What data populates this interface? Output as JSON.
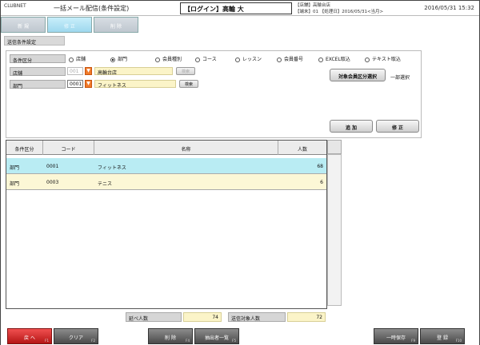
{
  "header": {
    "brand": "CLUBNET",
    "title": "一括メール配信(条件設定)",
    "login": "【ログイン】高輪 大",
    "store_line1": "【店舗】高輪台店",
    "store_line2": "【端末】01 【処理日】2016/05/31<当月>",
    "datetime": "2016/05/31 15:32"
  },
  "tabs": [
    {
      "label": "新 規"
    },
    {
      "label": "修 正"
    },
    {
      "label": "削 除"
    }
  ],
  "section_label": "送信条件設定",
  "conditions": {
    "category_label": "条件区分",
    "radios": [
      {
        "label": "店舗",
        "selected": false
      },
      {
        "label": "部門",
        "selected": true
      },
      {
        "label": "会員種別",
        "selected": false
      },
      {
        "label": "コース",
        "selected": false
      },
      {
        "label": "レッスン",
        "selected": false
      },
      {
        "label": "会員番号",
        "selected": false
      },
      {
        "label": "EXCEL取込",
        "selected": false
      },
      {
        "label": "テキスト取込",
        "selected": false
      }
    ],
    "store": {
      "label": "店舗",
      "code": "001",
      "name": "高輪台店",
      "search_label": "検索"
    },
    "dept": {
      "label": "部門",
      "code": "0001",
      "name": "フィットネス",
      "search_label": "検索"
    },
    "select_category_button": "対象会員区分選択",
    "partial_selection": "一部選択",
    "add_button": "追 加",
    "edit_button": "修 正"
  },
  "table": {
    "columns": [
      "条件区分",
      "コード",
      "名称",
      "人数"
    ],
    "rows": [
      {
        "category": "部門",
        "code": "0001",
        "name": "フィットネス",
        "count": "68"
      },
      {
        "category": "部門",
        "code": "0003",
        "name": "テニス",
        "count": "6"
      }
    ]
  },
  "totals": {
    "gross_label": "延べ人数",
    "gross_value": "74",
    "target_label": "送信対象人数",
    "target_value": "72"
  },
  "footer": [
    {
      "label": "戻 へ",
      "fkey": "F1"
    },
    {
      "label": "クリア",
      "fkey": "F2"
    },
    {
      "label": "削 除",
      "fkey": "F4"
    },
    {
      "label": "抽出者一覧",
      "fkey": "F5"
    },
    {
      "label": "一時保存",
      "fkey": "F9"
    },
    {
      "label": "登 録",
      "fkey": "F10"
    }
  ],
  "colors": {
    "selected_row": "#b9ecf3",
    "alt_row": "#fcf7d6",
    "back_button": "#d42020",
    "dropdown": "#f07a2a"
  }
}
